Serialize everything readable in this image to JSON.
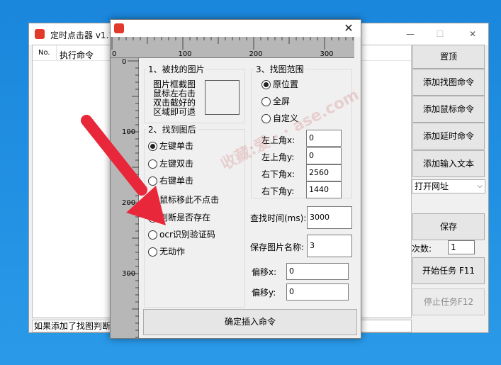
{
  "main_window": {
    "title": "定时点击器 v1.1",
    "list": {
      "col_no": "No.",
      "col_cmd": "执行命令"
    },
    "status_text": "如果添加了找图判断",
    "buttons": {
      "pin_top": "置顶",
      "add_find_image": "添加找图命令",
      "add_mouse": "添加鼠标命令",
      "add_delay": "添加延时命令",
      "add_input_text": "添加输入文本",
      "save": "保存",
      "start_task": "开始任务 F11",
      "stop_task": "停止任务F12"
    },
    "url_select": "打开网址",
    "count_label": "次数:",
    "count_value": "1",
    "controls": {
      "minimize": "—",
      "maximize": "☐",
      "close": "✕"
    }
  },
  "dialog": {
    "close": "✕",
    "ruler_h": [
      "0",
      "100",
      "200",
      "300"
    ],
    "ruler_v": [
      "0",
      "100",
      "200",
      "300"
    ],
    "section_image": {
      "title": "1、被找的图片",
      "hint": "图片框截图 鼠标左右击 双击截好的 区域即可退"
    },
    "section_after": {
      "title": "2、找到图后",
      "options": [
        "左键单击",
        "左键双击",
        "右键单击",
        "鼠标移此不点击",
        "判断是否存在",
        "ocr识别验证码",
        "无动作"
      ],
      "selected": 0
    },
    "section_range": {
      "title": "3、找图范围",
      "options": [
        "原位置",
        "全屏",
        "自定义"
      ],
      "selected": 0,
      "fields": [
        {
          "label": "左上角x:",
          "value": "0"
        },
        {
          "label": "左上角y:",
          "value": "0"
        },
        {
          "label": "右下角x:",
          "value": "2560"
        },
        {
          "label": "右下角y:",
          "value": "1440"
        }
      ]
    },
    "find_time": {
      "label": "查找时间(ms):",
      "value": "3000"
    },
    "save_name": {
      "label": "保存图片名称:",
      "value": "3"
    },
    "offset_x": {
      "label": "偏移x:",
      "value": "0"
    },
    "offset_y": {
      "label": "偏移y:",
      "value": "0"
    },
    "confirm": "确定插入命令"
  },
  "watermark": "收藏:爱 · · ase.com",
  "colors": {
    "desktop": "#1e8fe0",
    "arrow": "#e8283a",
    "app_icon": "#e23a2a"
  }
}
